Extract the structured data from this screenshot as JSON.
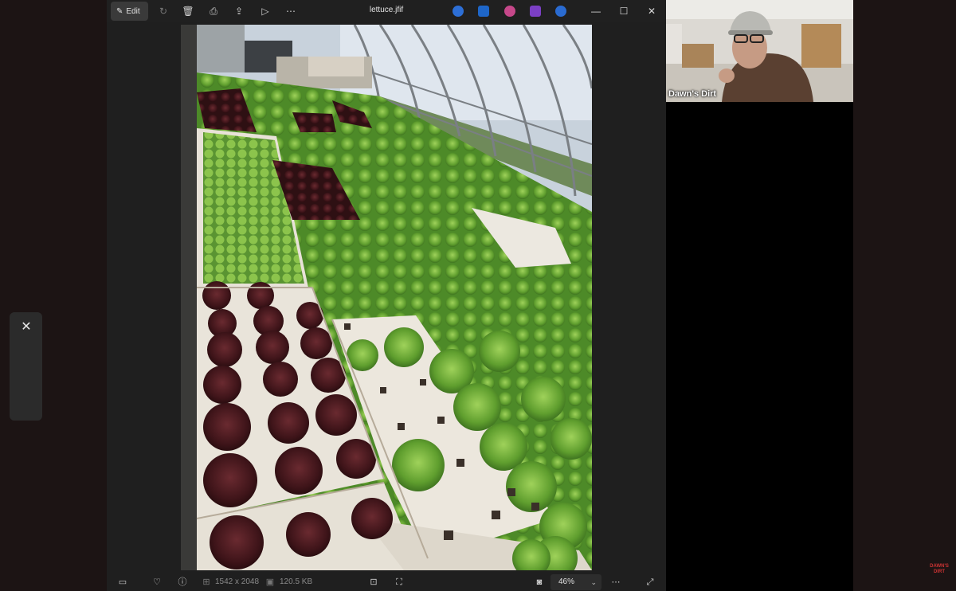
{
  "viewer": {
    "toolbar": {
      "edit_label": "Edit",
      "title": "lettuce.jfif"
    },
    "status": {
      "dimensions": "1542 x 2048",
      "filesize": "120.5 KB",
      "zoom": "46%"
    }
  },
  "webcam": {
    "name_label": "Dawn's Dirt"
  },
  "watermark": {
    "text": "DAWN'S DIRT"
  },
  "colors": {
    "background": "#1c1414",
    "toolbar": "#202020",
    "lettuce_green": "#6fae3a",
    "lettuce_red": "#4a1a1f"
  }
}
